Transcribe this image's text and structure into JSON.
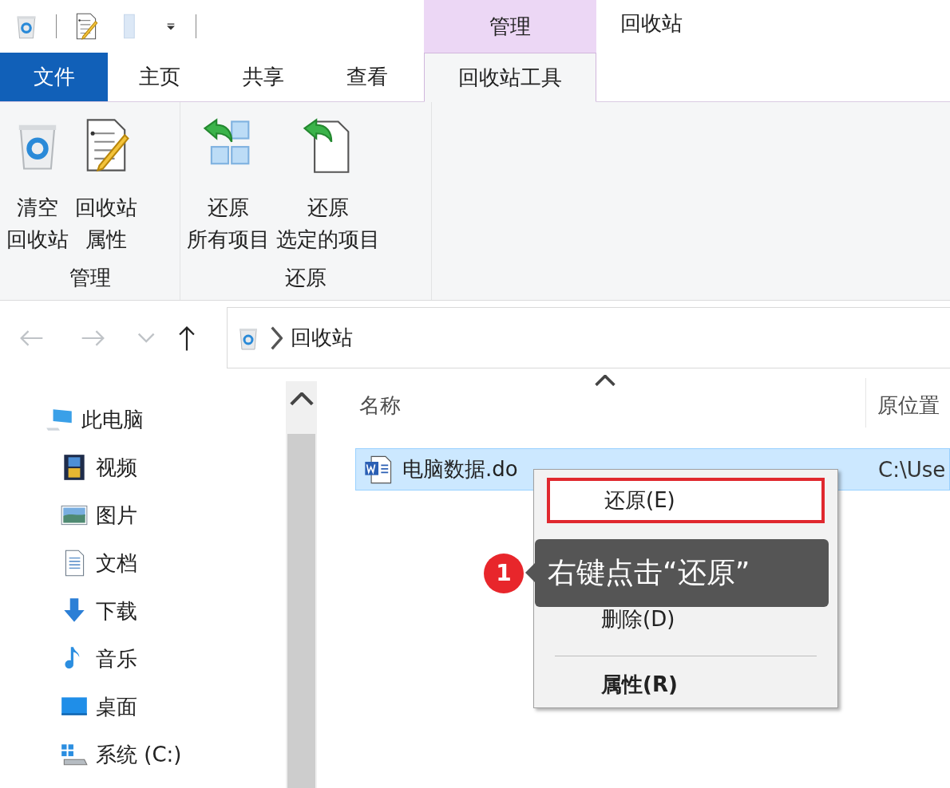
{
  "quick_access": {
    "icons": [
      {
        "kind": "bin"
      },
      {
        "kind": "properties"
      },
      {
        "kind": "folder"
      },
      {
        "kind": "dropdown"
      }
    ]
  },
  "context_tab": {
    "label": "管理"
  },
  "window": {
    "title": "回收站"
  },
  "tabs": [
    {
      "label": "文件",
      "kind": "file",
      "selected": false
    },
    {
      "label": "主页",
      "kind": "normal",
      "selected": false
    },
    {
      "label": "共享",
      "kind": "normal",
      "selected": false
    },
    {
      "label": "查看",
      "kind": "normal",
      "selected": false
    },
    {
      "label": "回收站工具",
      "kind": "context",
      "selected": true
    }
  ],
  "ribbon": {
    "groups": [
      {
        "label": "管理",
        "buttons": [
          {
            "kind": "empty-bin",
            "lines": [
              "清空",
              "回收站"
            ]
          },
          {
            "kind": "properties",
            "lines": [
              "回收站",
              "属性"
            ]
          }
        ]
      },
      {
        "label": "还原",
        "buttons": [
          {
            "kind": "restore-all",
            "lines": [
              "还原",
              "所有项目"
            ]
          },
          {
            "kind": "restore-selected",
            "lines": [
              "还原",
              "选定的项目"
            ]
          }
        ]
      }
    ]
  },
  "nav_buttons": [
    {
      "kind": "back",
      "disabled": true
    },
    {
      "kind": "forward",
      "disabled": true
    },
    {
      "kind": "recent",
      "disabled": true
    },
    {
      "kind": "up",
      "disabled": false
    }
  ],
  "address_bar": {
    "path": [
      "回收站"
    ]
  },
  "sidebar": {
    "items": [
      {
        "label": "此电脑",
        "kind": "pc",
        "children": [
          {
            "label": "视频",
            "kind": "video"
          },
          {
            "label": "图片",
            "kind": "pictures"
          },
          {
            "label": "文档",
            "kind": "documents"
          },
          {
            "label": "下载",
            "kind": "downloads"
          },
          {
            "label": "音乐",
            "kind": "music"
          },
          {
            "label": "桌面",
            "kind": "desktop"
          },
          {
            "label": "系统 (C:)",
            "kind": "drive"
          }
        ]
      }
    ]
  },
  "file_list": {
    "columns": [
      "名称",
      "原位置"
    ],
    "rows": [
      {
        "cells": [
          "电脑数据.do",
          "C:\\Use"
        ],
        "selected": true
      }
    ]
  },
  "context_menu": {
    "items": [
      {
        "kind": "item",
        "label": "还原(E)",
        "highlighted": true,
        "bold": false
      },
      {
        "kind": "item",
        "label": "删除(D)",
        "highlighted": false,
        "bold": false
      },
      {
        "kind": "separator"
      },
      {
        "kind": "item",
        "label": "属性(R)",
        "highlighted": false,
        "bold": true
      }
    ]
  },
  "callout": {
    "step": "1",
    "text": "右键点击“还原”"
  }
}
